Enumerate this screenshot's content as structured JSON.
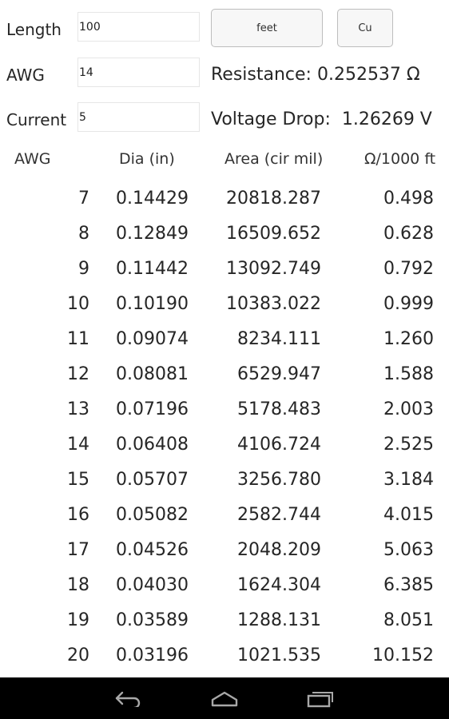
{
  "inputs": {
    "length_label": "Length",
    "length_value": "100",
    "awg_label": "AWG",
    "awg_value": "14",
    "current_label": "Current",
    "current_value": "5"
  },
  "buttons": {
    "unit_label": "feet",
    "material_label": "Cu"
  },
  "results": {
    "resistance_text": "Resistance: 0.252537 Ω",
    "voltage_drop_text": "Voltage Drop:  1.26269 V"
  },
  "table": {
    "headers": {
      "awg": "AWG",
      "dia": "Dia (in)",
      "area": "Area (cir mil)",
      "ohm": "Ω/1000 ft"
    },
    "rows": [
      {
        "awg": "7",
        "dia": "0.14429",
        "area": "20818.287",
        "ohm": "0.498"
      },
      {
        "awg": "8",
        "dia": "0.12849",
        "area": "16509.652",
        "ohm": "0.628"
      },
      {
        "awg": "9",
        "dia": "0.11442",
        "area": "13092.749",
        "ohm": "0.792"
      },
      {
        "awg": "10",
        "dia": "0.10190",
        "area": "10383.022",
        "ohm": "0.999"
      },
      {
        "awg": "11",
        "dia": "0.09074",
        "area": "8234.111",
        "ohm": "1.260"
      },
      {
        "awg": "12",
        "dia": "0.08081",
        "area": "6529.947",
        "ohm": "1.588"
      },
      {
        "awg": "13",
        "dia": "0.07196",
        "area": "5178.483",
        "ohm": "2.003"
      },
      {
        "awg": "14",
        "dia": "0.06408",
        "area": "4106.724",
        "ohm": "2.525"
      },
      {
        "awg": "15",
        "dia": "0.05707",
        "area": "3256.780",
        "ohm": "3.184"
      },
      {
        "awg": "16",
        "dia": "0.05082",
        "area": "2582.744",
        "ohm": "4.015"
      },
      {
        "awg": "17",
        "dia": "0.04526",
        "area": "2048.209",
        "ohm": "5.063"
      },
      {
        "awg": "18",
        "dia": "0.04030",
        "area": "1624.304",
        "ohm": "6.385"
      },
      {
        "awg": "19",
        "dia": "0.03589",
        "area": "1288.131",
        "ohm": "8.051"
      },
      {
        "awg": "20",
        "dia": "0.03196",
        "area": "1021.535",
        "ohm": "10.152"
      }
    ]
  },
  "navbar": {
    "icons": [
      "back-icon",
      "home-icon",
      "recent-apps-icon"
    ],
    "background": "#000000",
    "icon_color": "#a8a8a8"
  }
}
